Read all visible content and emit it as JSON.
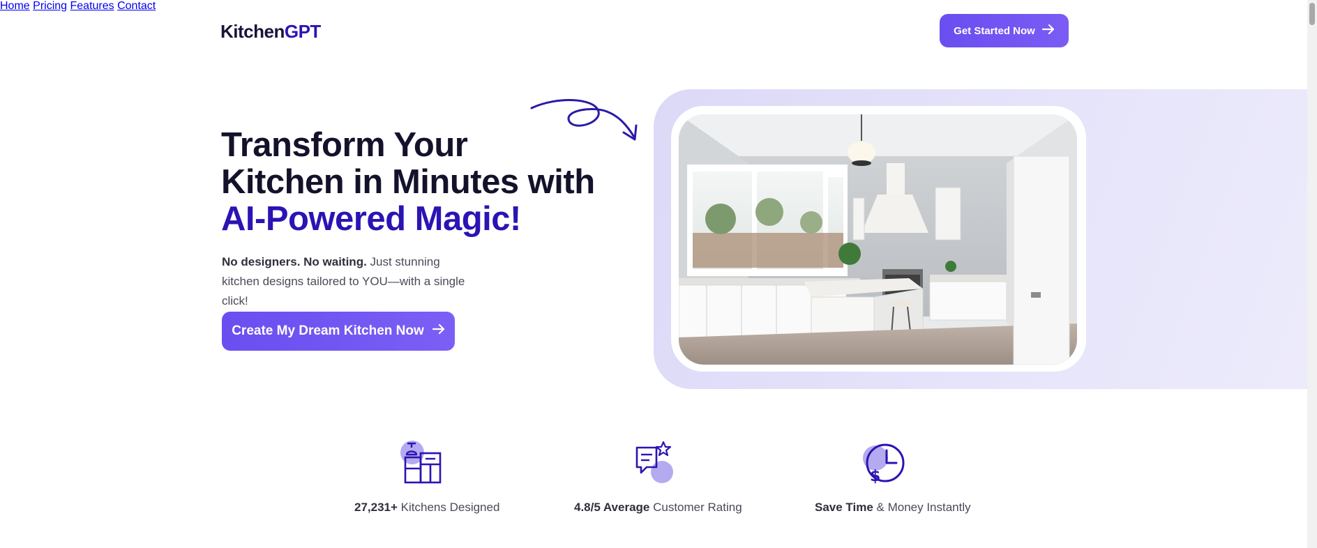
{
  "header": {
    "logo_part1": "Kitchen",
    "logo_part2": "GPT",
    "nav": [
      "Home",
      "Pricing",
      "Features",
      "Contact"
    ],
    "cta_label": "Get Started Now",
    "cta_icon": "arrow-right-icon"
  },
  "hero": {
    "title_line1": "Transform Your",
    "title_line2": "Kitchen in Minutes with",
    "title_line3": "AI-Powered Magic!",
    "sub_bold": "No designers. No waiting.",
    "sub_rest": " Just stunning kitchen designs tailored to YOU—with a single click!",
    "cta_label": "Create My Dream Kitchen Now",
    "cta_icon": "arrow-right-icon",
    "decoration_icon": "swirl-arrow-icon",
    "image": "kitchen-photo"
  },
  "stats": [
    {
      "icon": "kitchen-icon",
      "bold": "27,231+",
      "rest": " Kitchens Designed"
    },
    {
      "icon": "rating-chat-icon",
      "bold": "4.8/5 Average",
      "rest": " Customer Rating"
    },
    {
      "icon": "clock-money-icon",
      "bold": "Save Time",
      "rest": " & Money Instantly"
    }
  ],
  "colors": {
    "brand": "#2a14b4",
    "button": "#6a4ef0",
    "panel": "#e3e1f9",
    "icon_bubble": "#b3aaf0"
  }
}
